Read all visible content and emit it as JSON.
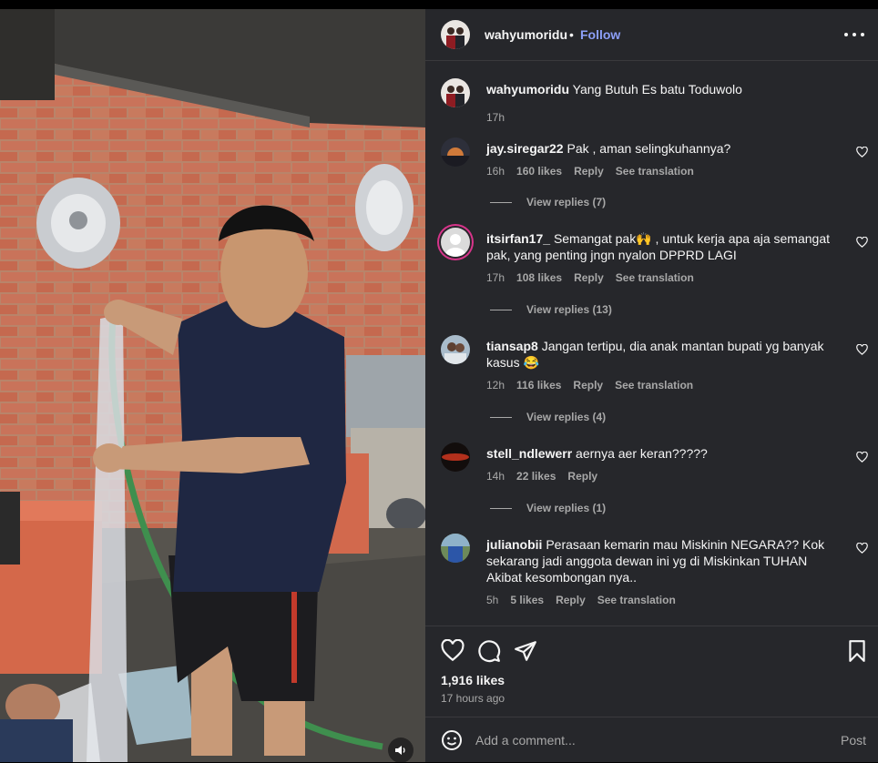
{
  "post": {
    "username": "wahyumoridu",
    "separator": "•",
    "follow_label": "Follow",
    "caption": "Yang Butuh Es batu Toduwolo",
    "caption_time": "17h",
    "likes": "1,916 likes",
    "time_ago": "17 hours ago"
  },
  "comments": [
    {
      "user": "jay.siregar22",
      "text": "Pak , aman selingkuhannya?",
      "time": "16h",
      "likes": "160 likes",
      "reply": "Reply",
      "translate": "See translation",
      "view_replies": "View replies (7)",
      "avatar_color": "#3a3a44"
    },
    {
      "user": "itsirfan17_",
      "text": "Semangat pak🙌 , untuk kerja apa aja semangat pak, yang penting jngn nyalon DPPRD LAGI",
      "time": "17h",
      "likes": "108 likes",
      "reply": "Reply",
      "translate": "See translation",
      "view_replies": "View replies (13)",
      "avatar_color": "#dbdbdb"
    },
    {
      "user": "tiansap8",
      "text": "Jangan tertipu, dia anak mantan bupati yg banyak kasus 😂",
      "time": "12h",
      "likes": "116 likes",
      "reply": "Reply",
      "translate": "See translation",
      "view_replies": "View replies (4)",
      "avatar_color": "#8aa0b0"
    },
    {
      "user": "stell_ndlewerr",
      "text": "aernya aer keran?????",
      "time": "14h",
      "likes": "22 likes",
      "reply": "Reply",
      "translate": "",
      "view_replies": "View replies (1)",
      "avatar_color": "#5a1a14"
    },
    {
      "user": "julianobii",
      "text": "Perasaan kemarin mau Miskinin NEGARA?? Kok sekarang jadi anggota dewan ini yg di Miskinkan TUHAN Akibat kesombongan nya..",
      "time": "5h",
      "likes": "5 likes",
      "reply": "Reply",
      "translate": "See translation",
      "view_replies": "",
      "avatar_color": "#3d6a8a"
    }
  ],
  "composer": {
    "placeholder": "Add a comment...",
    "post_label": "Post"
  },
  "icons": {
    "like": "heart-icon",
    "comment": "comment-icon",
    "share": "paper-plane-icon",
    "save": "bookmark-icon",
    "emoji": "smiley-icon",
    "more": "ellipsis-icon",
    "mute": "speaker-icon"
  },
  "colors": {
    "panel_bg": "#26272b",
    "follow": "#8c9ff8",
    "meta_text": "#a8a8a8",
    "text": "#f5f5f5"
  }
}
